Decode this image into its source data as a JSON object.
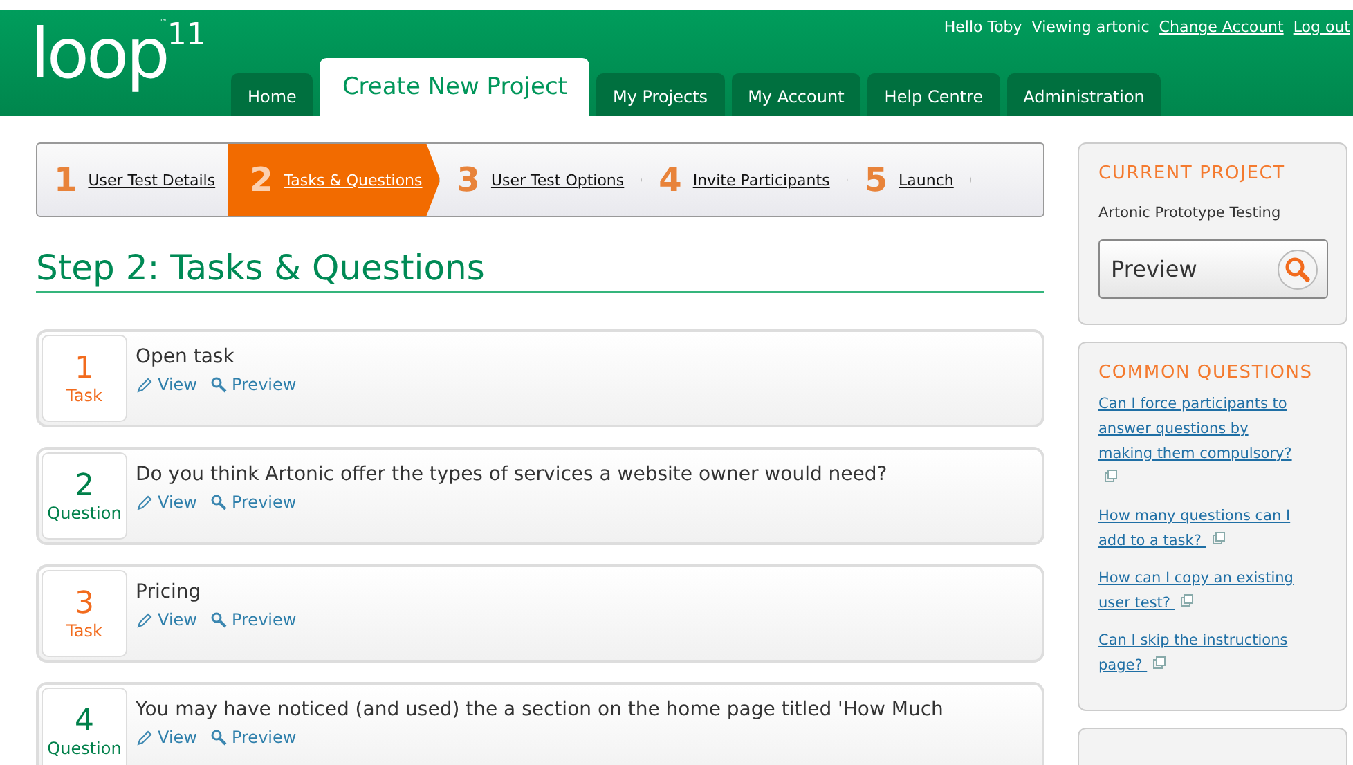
{
  "header": {
    "logo": "loop",
    "logo_sup": "11",
    "tm": "™",
    "greeting": "Hello Toby",
    "viewing": "Viewing artonic",
    "links": [
      "Change Account",
      "Log out"
    ]
  },
  "tabs": [
    {
      "label": "Home",
      "selected": false
    },
    {
      "label": "Create New Project",
      "selected": true
    },
    {
      "label": "My Projects",
      "selected": false
    },
    {
      "label": "My Account",
      "selected": false
    },
    {
      "label": "Help Centre",
      "selected": false
    },
    {
      "label": "Administration",
      "selected": false
    }
  ],
  "steps": [
    {
      "number": "1",
      "label": "User Test Details",
      "selected": false
    },
    {
      "number": "2",
      "label": "Tasks & Questions",
      "selected": true
    },
    {
      "number": "3",
      "label": "User Test Options",
      "selected": false
    },
    {
      "number": "4",
      "label": "Invite Participants",
      "selected": false
    },
    {
      "number": "5",
      "label": "Launch",
      "selected": false
    }
  ],
  "heading": "Step 2: Tasks & Questions",
  "items": [
    {
      "number": "1",
      "kind": "task",
      "type_label": "Task",
      "title": "Open task",
      "actions": [
        "View",
        "Preview"
      ]
    },
    {
      "number": "2",
      "kind": "question",
      "type_label": "Question",
      "title": "Do you think Artonic offer the types of services a website owner would need?",
      "actions": [
        "View",
        "Preview"
      ]
    },
    {
      "number": "3",
      "kind": "task",
      "type_label": "Task",
      "title": "Pricing",
      "actions": [
        "View",
        "Preview"
      ]
    },
    {
      "number": "4",
      "kind": "question",
      "type_label": "Question",
      "title": "You may have noticed (and used) the a section on the home page titled 'How Much",
      "actions": [
        "View",
        "Preview"
      ]
    }
  ],
  "current_project": {
    "heading": "CURRENT PROJECT",
    "name": "Artonic Prototype Testing",
    "button": "Preview"
  },
  "common_questions": {
    "heading": "COMMON QUESTIONS",
    "links": [
      "Can I force participants to answer questions by making them compulsory?",
      "How many questions can I add to a task?",
      "How can I copy an existing user test?",
      "Can I skip the instructions page?"
    ]
  }
}
